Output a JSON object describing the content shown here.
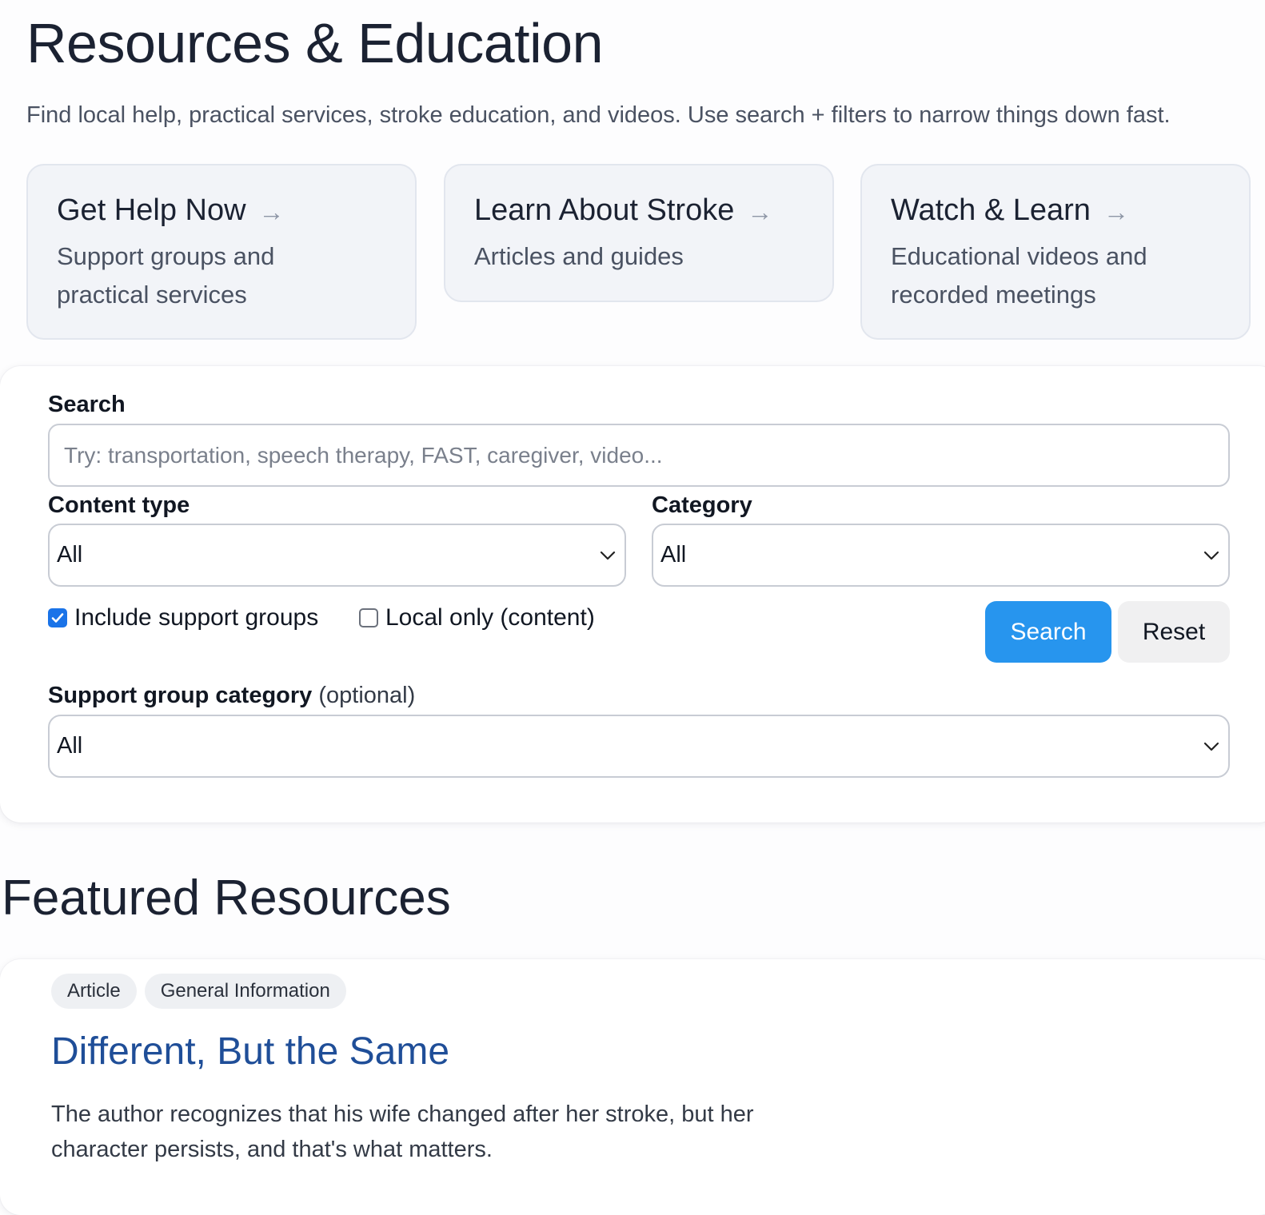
{
  "header": {
    "title": "Resources & Education",
    "intro": "Find local help, practical services, stroke education, and videos. Use search + filters to narrow things down fast."
  },
  "quick_links": [
    {
      "title": "Get Help Now",
      "arrow": "→",
      "description": "Support groups and practical services",
      "icon": "arrow-right-icon"
    },
    {
      "title": "Learn About Stroke",
      "arrow": "→",
      "description": "Articles and guides",
      "icon": "arrow-right-icon"
    },
    {
      "title": "Watch & Learn",
      "arrow": "→",
      "description": "Educational videos and recorded meetings",
      "icon": "arrow-right-icon"
    }
  ],
  "filters": {
    "search_label": "Search",
    "search_value": "",
    "search_placeholder": "Try: transportation, speech therapy, FAST, caregiver, video...",
    "content_type_label": "Content type",
    "content_type_value": "All",
    "category_label": "Category",
    "category_value": "All",
    "include_support_groups_label": "Include support groups",
    "include_support_groups_checked": true,
    "local_only_label": "Local only (content)",
    "local_only_checked": false,
    "search_button": "Search",
    "reset_button": "Reset",
    "support_group_category_label": "Support group category",
    "support_group_category_optional": "(optional)",
    "support_group_category_value": "All"
  },
  "featured": {
    "section_title": "Featured Resources",
    "items": [
      {
        "tags": [
          "Article",
          "General Information"
        ],
        "title": "Different, But the Same",
        "description": "The author recognizes that his wife changed after her stroke, but her character persists, and that's what matters."
      }
    ]
  },
  "colors": {
    "accent": "#2795ee",
    "link": "#1f4e98",
    "checkbox": "#1a73e8",
    "card_bg": "#f2f4f8"
  }
}
